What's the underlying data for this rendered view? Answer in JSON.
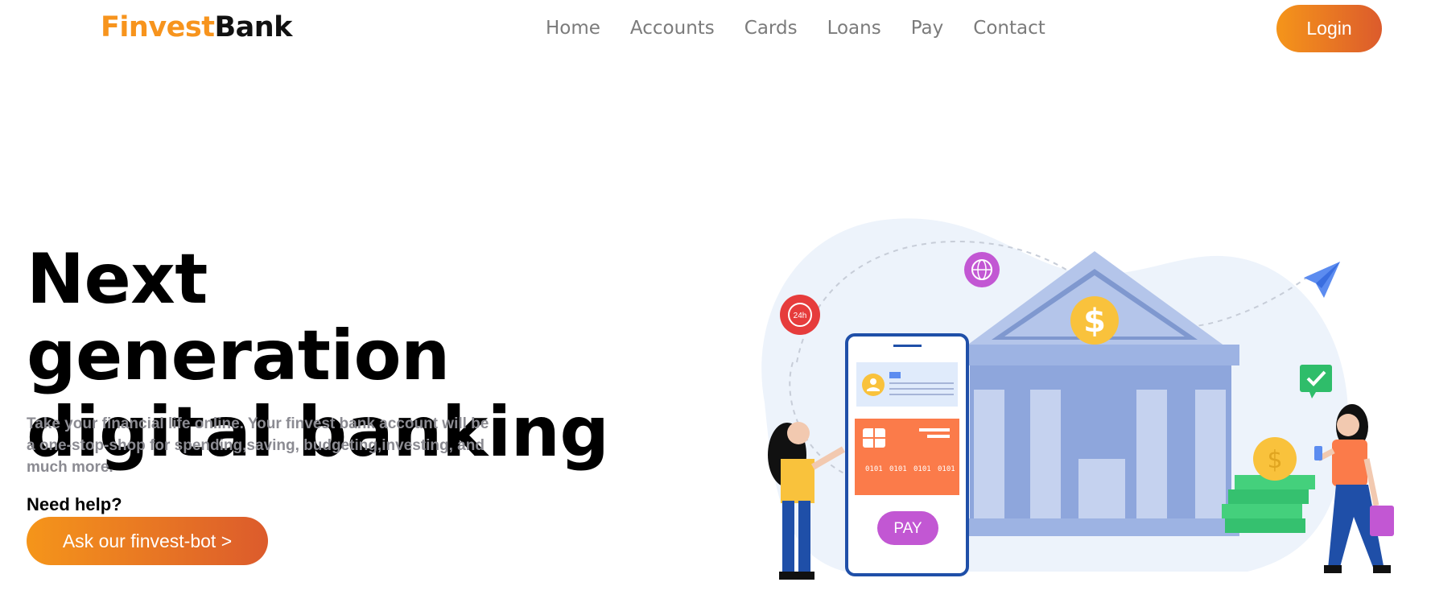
{
  "brand": {
    "part1": "Finvest",
    "part2": "Bank"
  },
  "nav": [
    "Home",
    "Accounts",
    "Cards",
    "Loans",
    "Pay",
    "Contact"
  ],
  "login_label": "Login",
  "hero": {
    "title_line1": "Next generation",
    "title_line2": "digital banking",
    "description": "Take your financial life online. Your finvest bank account will be a one-stop-shop for spending,saving, budgeting,investing, and much more.",
    "help_label": "Need help?",
    "bot_button": "Ask our finvest-bot >"
  },
  "illustration": {
    "card_numbers": [
      "0101",
      "0101",
      "0101",
      "0101"
    ],
    "pay_label": "PAY",
    "clock_label": "24h",
    "dollar_symbol": "$",
    "icons": [
      "clock-24h-icon",
      "globe-icon",
      "paper-plane-icon",
      "dollar-coin-icon",
      "checkmark-chat-icon",
      "bank-icon",
      "user-icon",
      "card-chip-icon"
    ]
  },
  "colors": {
    "brand_orange": "#f7941d",
    "gradient_end": "#dc5b2c",
    "bank_blue": "#8ea6dc",
    "phone_blue": "#1f4fa8",
    "card_orange": "#fb7b4a",
    "pay_purple": "#c257d3"
  }
}
